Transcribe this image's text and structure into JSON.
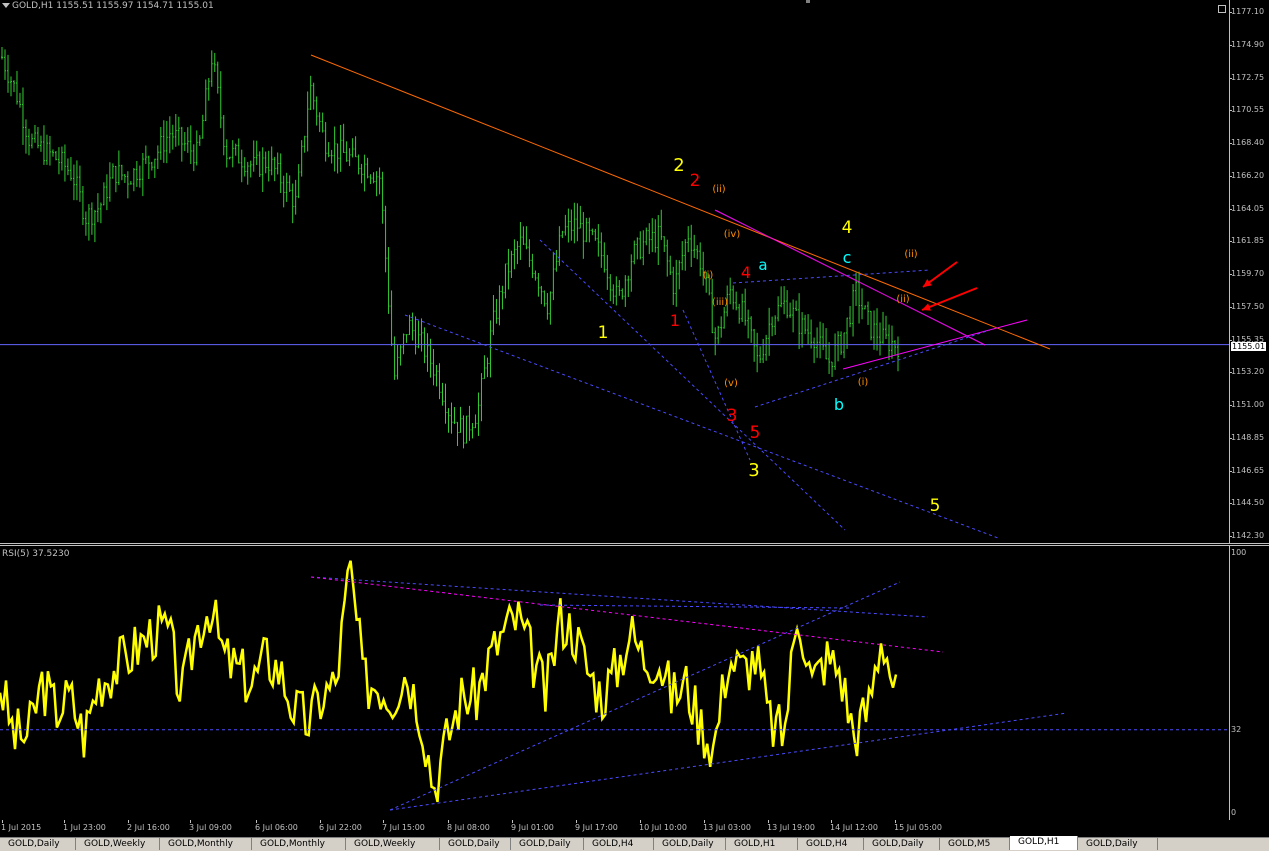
{
  "header": {
    "symbol_label": "GOLD,H1  1155.51 1155.97 1154.71 1155.01",
    "rsi_label": "RSI(5) 37.5230"
  },
  "price_axis": {
    "ticks": [
      "1177.10",
      "1174.90",
      "1172.75",
      "1170.55",
      "1168.40",
      "1166.20",
      "1164.05",
      "1161.85",
      "1159.70",
      "1157.50",
      "1155.35",
      "1153.20",
      "1151.00",
      "1148.85",
      "1146.65",
      "1144.50",
      "1142.30"
    ],
    "current_price": "1155.01"
  },
  "rsi_axis": {
    "ticks": [
      "100",
      "32",
      "0"
    ]
  },
  "time_axis": {
    "ticks": [
      "1 Jul 2015",
      "1 Jul 23:00",
      "2 Jul 16:00",
      "3 Jul 09:00",
      "6 Jul 06:00",
      "6 Jul 22:00",
      "7 Jul 15:00",
      "8 Jul 08:00",
      "9 Jul 01:00",
      "9 Jul 17:00",
      "10 Jul 10:00",
      "13 Jul 03:00",
      "13 Jul 19:00",
      "14 Jul 12:00",
      "15 Jul 05:00"
    ]
  },
  "wave_labels": [
    {
      "text": "2",
      "color": "#ffff00"
    },
    {
      "text": "2",
      "color": "#ff0000"
    },
    {
      "text": "(ii)",
      "color": "#ff8c00"
    },
    {
      "text": "(iv)",
      "color": "#ff8c00"
    },
    {
      "text": "(i)",
      "color": "#ff8c00"
    },
    {
      "text": "(iii)",
      "color": "#ff8c00"
    },
    {
      "text": "(v)",
      "color": "#ff8c00"
    },
    {
      "text": "1",
      "color": "#ffff00"
    },
    {
      "text": "1",
      "color": "#ff0000"
    },
    {
      "text": "3",
      "color": "#ff0000"
    },
    {
      "text": "5",
      "color": "#ff0000"
    },
    {
      "text": "3",
      "color": "#ffff00"
    },
    {
      "text": "4",
      "color": "#ff0000"
    },
    {
      "text": "a",
      "color": "#00ffff"
    },
    {
      "text": "4",
      "color": "#ffff00"
    },
    {
      "text": "c",
      "color": "#00ffff"
    },
    {
      "text": "b",
      "color": "#00ffff"
    },
    {
      "text": "(i)",
      "color": "#ff8c00"
    },
    {
      "text": "(ii)",
      "color": "#ff8c00"
    },
    {
      "text": "(ii)",
      "color": "#ff8c00"
    },
    {
      "text": "5",
      "color": "#ffff00"
    }
  ],
  "tabs": [
    {
      "label": "GOLD,Daily",
      "active": false
    },
    {
      "label": "GOLD,Weekly",
      "active": false
    },
    {
      "label": "GOLD,Monthly",
      "active": false
    },
    {
      "label": "GOLD,Monthly",
      "active": false
    },
    {
      "label": "GOLD,Weekly",
      "active": false
    },
    {
      "label": "GOLD,Daily",
      "active": false
    },
    {
      "label": "GOLD,Daily",
      "active": false
    },
    {
      "label": "GOLD,H4",
      "active": false
    },
    {
      "label": "GOLD,Daily",
      "active": false
    },
    {
      "label": "GOLD,H1",
      "active": false
    },
    {
      "label": "GOLD,H4",
      "active": false
    },
    {
      "label": "GOLD,Daily",
      "active": false
    },
    {
      "label": "GOLD,M5",
      "active": false
    },
    {
      "label": "GOLD,H1",
      "active": true
    },
    {
      "label": "GOLD,Daily",
      "active": false
    }
  ],
  "colors": {
    "candles": "#32cd32",
    "rsi_line": "#ffff00",
    "trend_orange": "#ff6a00",
    "trend_magenta": "#ff00ff",
    "dashed_blue": "#4a4aff",
    "price_line": "#6464ff",
    "arrows": "#ff0000"
  },
  "chart_data": {
    "type": "line",
    "price": {
      "close_approx": [
        1174.1,
        1171.8,
        1168.5,
        1167.9,
        1167.3,
        1166.4,
        1163.5,
        1164.2,
        1166.5,
        1166.1,
        1166.9,
        1167.7,
        1169.1,
        1168.3,
        1167.6,
        1174.2,
        1167.8,
        1167.5,
        1166.8,
        1167.2,
        1165.9,
        1164.4,
        1172.2,
        1168.6,
        1167.9,
        1167.3,
        1166.9,
        1166.1,
        1152.8,
        1156.4,
        1155.0,
        1153.2,
        1150.4,
        1149.2,
        1150.7,
        1156.1,
        1159.8,
        1161.8,
        1160.1,
        1157.6,
        1162.5,
        1163.0,
        1162.1,
        1160.7,
        1157.9,
        1160.9,
        1161.9,
        1162.2,
        1158.8,
        1162.4,
        1160.3,
        1155.2,
        1158.6,
        1156.9,
        1153.8,
        1157.0,
        1157.8,
        1156.3,
        1155.6,
        1153.8,
        1155.3,
        1158.5,
        1156.2,
        1155.3,
        1155.0
      ],
      "ylim": [
        1142.3,
        1177.1
      ]
    },
    "rsi": {
      "values_approx": [
        50,
        30,
        30,
        50,
        40,
        45,
        30,
        50,
        55,
        60,
        65,
        70,
        70,
        45,
        70,
        80,
        60,
        55,
        50,
        60,
        55,
        40,
        35,
        45,
        50,
        95,
        50,
        50,
        45,
        55,
        40,
        10,
        30,
        45,
        45,
        60,
        70,
        75,
        60,
        45,
        75,
        70,
        55,
        45,
        55,
        70,
        60,
        60,
        45,
        50,
        35,
        25,
        60,
        55,
        60,
        35,
        30,
        80,
        50,
        60,
        55,
        30,
        40,
        70,
        45
      ],
      "ylim": [
        0,
        100
      ],
      "level": 32
    }
  }
}
